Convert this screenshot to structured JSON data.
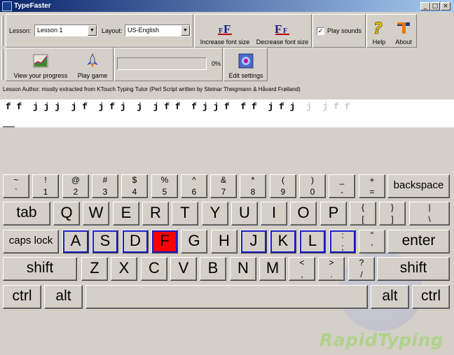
{
  "window": {
    "title": "TypeFaster",
    "minimize": "_",
    "maximize": "□",
    "close": "×"
  },
  "toolbar1": {
    "lesson_label": "Lesson:",
    "lesson_value": "Lesson 1",
    "layout_label": "Layout:",
    "layout_value": "US-English",
    "increase_font": "Increase font size",
    "decrease_font": "Decrease font size",
    "play_sounds": "Play sounds",
    "play_sounds_checked": "✓",
    "help": "Help",
    "about": "About"
  },
  "toolbar2": {
    "view_progress": "View your progress",
    "play_game": "Play game",
    "progress_percent": "0%",
    "progress_value": 0,
    "edit_settings": "Edit settings"
  },
  "lesson_author": "Lesson Author: mostly extracted from KTouch Typing Tutor (Perl Script written by Steinar Theigmann & Håvard Frøiland)",
  "typing": {
    "done": "f f  j j j  j f  j f j  j  j f f  f j j f  f f  j f j ",
    "todo": " j  j f f"
  },
  "keyboard": {
    "row1": [
      {
        "top": "~",
        "bot": "`"
      },
      {
        "top": "!",
        "bot": "1"
      },
      {
        "top": "@",
        "bot": "2"
      },
      {
        "top": "#",
        "bot": "3"
      },
      {
        "top": "$",
        "bot": "4"
      },
      {
        "top": "%",
        "bot": "5"
      },
      {
        "top": "^",
        "bot": "6"
      },
      {
        "top": "&",
        "bot": "7"
      },
      {
        "top": "*",
        "bot": "8"
      },
      {
        "top": "(",
        "bot": "9"
      },
      {
        "top": ")",
        "bot": "0"
      },
      {
        "top": "_",
        "bot": "-"
      },
      {
        "top": "+",
        "bot": "="
      }
    ],
    "backspace": "backspace",
    "tab": "tab",
    "row2": [
      "Q",
      "W",
      "E",
      "R",
      "T",
      "Y",
      "U",
      "I",
      "O",
      "P"
    ],
    "row2_sym": [
      {
        "top": "{",
        "bot": "["
      },
      {
        "top": "}",
        "bot": "]"
      },
      {
        "top": "|",
        "bot": "\\"
      }
    ],
    "caps": "caps lock",
    "row3": [
      "A",
      "S",
      "D",
      "F",
      "G",
      "H",
      "J",
      "K",
      "L"
    ],
    "row3_sym": [
      {
        "top": ":",
        "bot": ";"
      },
      {
        "top": "\"",
        "bot": "'"
      }
    ],
    "enter": "enter",
    "shift_left": "shift",
    "row4": [
      "Z",
      "X",
      "C",
      "V",
      "B",
      "N",
      "M"
    ],
    "row4_sym": [
      {
        "top": "<",
        "bot": ","
      },
      {
        "top": ">",
        "bot": "."
      },
      {
        "top": "?",
        "bot": "/"
      }
    ],
    "shift_right": "shift",
    "ctrl_left": "ctrl",
    "alt_left": "alt",
    "alt_right": "alt",
    "ctrl_right": "ctrl",
    "active_key": "F",
    "highlight_color": "#ff0000",
    "home_outline_color": "#1c1cc4"
  },
  "watermark": "RapidTyping"
}
